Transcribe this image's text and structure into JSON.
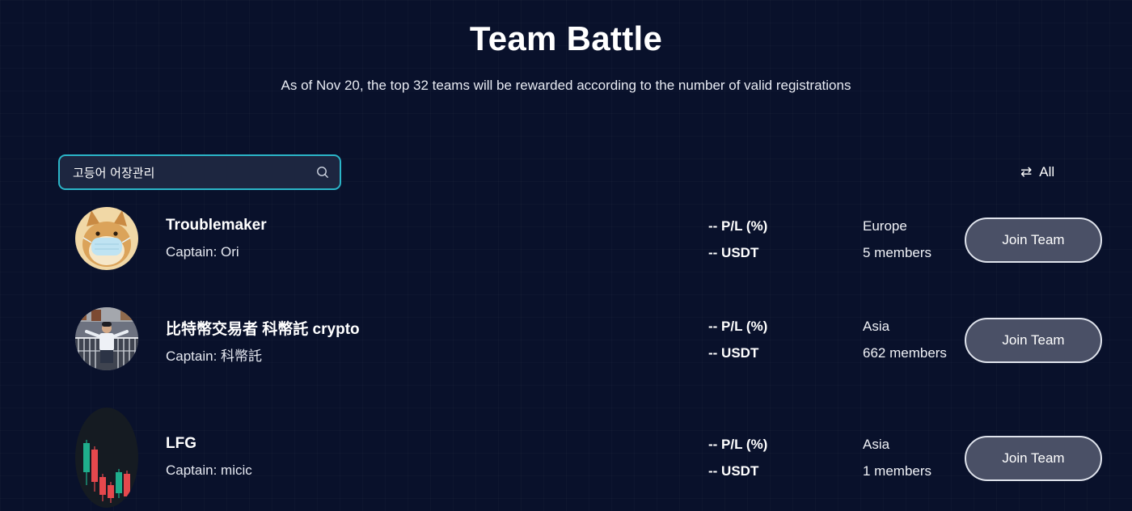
{
  "header": {
    "title": "Team Battle",
    "subtitle": "As of Nov 20, the top 32 teams will be rewarded according to the number of valid registrations"
  },
  "search": {
    "value": "고등어 어장관리",
    "icon": "search-icon"
  },
  "filter": {
    "label": "All",
    "icon": "swap-arrows-icon"
  },
  "teams": [
    {
      "name": "Troublemaker",
      "captain": "Captain: Ori",
      "pl": "-- P/L (%)",
      "usdt": "-- USDT",
      "region": "Europe",
      "members": "5 members",
      "join_label": "Join Team",
      "avatar": "shiba-dog-with-mask-avatar"
    },
    {
      "name": "比特幣交易者 科幣託 crypto",
      "captain": "Captain: 科幣託",
      "pl": "-- P/L (%)",
      "usdt": "-- USDT",
      "region": "Asia",
      "members": "662 members",
      "join_label": "Join Team",
      "avatar": "person-photo-avatar"
    },
    {
      "name": "LFG",
      "captain": "Captain: micic",
      "pl": "-- P/L (%)",
      "usdt": "-- USDT",
      "region": "Asia",
      "members": "1 members",
      "join_label": "Join Team",
      "avatar": "candlestick-chart-avatar"
    }
  ],
  "colors": {
    "background": "#09112b",
    "search_border": "#2bb5c8",
    "button_fill": "#4a5066",
    "button_border": "#dfe3ec",
    "candle_green": "#1fae8c",
    "candle_red": "#e5484d"
  }
}
